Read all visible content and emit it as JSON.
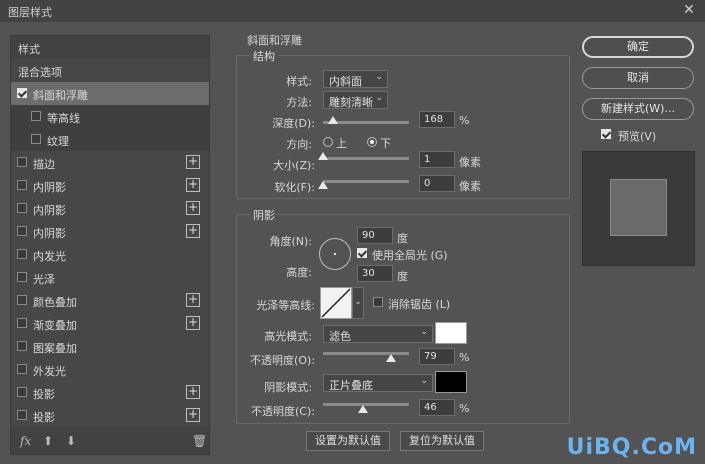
{
  "window": {
    "title": "图层样式",
    "close_glyph": "✕"
  },
  "left_panel": {
    "styles_header": "样式",
    "blend_options": "混合选项",
    "items": [
      {
        "label": "斜面和浮雕",
        "checked": true,
        "selected": true,
        "has_plus": false
      },
      {
        "label": "等高线",
        "checked": false,
        "sub": true,
        "has_plus": false
      },
      {
        "label": "纹理",
        "checked": false,
        "sub": true,
        "has_plus": false
      },
      {
        "label": "描边",
        "checked": false,
        "has_plus": true
      },
      {
        "label": "内阴影",
        "checked": false,
        "has_plus": true
      },
      {
        "label": "内阴影",
        "checked": false,
        "has_plus": true
      },
      {
        "label": "内阴影",
        "checked": false,
        "has_plus": true
      },
      {
        "label": "内发光",
        "checked": false,
        "has_plus": false
      },
      {
        "label": "光泽",
        "checked": false,
        "has_plus": false
      },
      {
        "label": "颜色叠加",
        "checked": false,
        "has_plus": true
      },
      {
        "label": "渐变叠加",
        "checked": false,
        "has_plus": true
      },
      {
        "label": "图案叠加",
        "checked": false,
        "has_plus": false
      },
      {
        "label": "外发光",
        "checked": false,
        "has_plus": false
      },
      {
        "label": "投影",
        "checked": false,
        "has_plus": true
      },
      {
        "label": "投影",
        "checked": false,
        "has_plus": true
      }
    ],
    "plus_glyph": "+",
    "toolbar": {
      "fx": "fx",
      "up": "⬆",
      "down": "⬇",
      "trash": "🗑"
    }
  },
  "bevel": {
    "section_title": "斜面和浮雕",
    "structure": {
      "legend": "结构",
      "style_label": "样式:",
      "style_value": "内斜面",
      "method_label": "方法:",
      "method_value": "雕刻清晰",
      "depth_label": "深度(D):",
      "depth_value": "168",
      "depth_unit": "%",
      "depth_level": 0.12,
      "direction_label": "方向:",
      "dir_up": "上",
      "dir_down": "下",
      "direction_selected": "下",
      "size_label": "大小(Z):",
      "size_value": "1",
      "size_unit": "像素",
      "size_level": 0.0,
      "soften_label": "软化(F):",
      "soften_value": "0",
      "soften_unit": "像素",
      "soften_level": 0.0
    },
    "shading": {
      "legend": "阴影",
      "angle_label": "角度(N):",
      "angle_value": "90",
      "angle_unit": "度",
      "global_light_label": "使用全局光 (G)",
      "global_light_checked": true,
      "altitude_label": "高度:",
      "altitude_value": "30",
      "altitude_unit": "度",
      "gloss_contour_label": "光泽等高线:",
      "anti_alias_label": "消除锯齿 (L)",
      "anti_alias_checked": false,
      "highlight_mode_label": "高光模式:",
      "highlight_mode_value": "滤色",
      "highlight_color": "#ffffff",
      "highlight_opacity_label": "不透明度(O):",
      "highlight_opacity_value": "79",
      "highlight_opacity_unit": "%",
      "highlight_opacity_level": 0.79,
      "shadow_mode_label": "阴影模式:",
      "shadow_mode_value": "正片叠底",
      "shadow_color": "#000000",
      "shadow_opacity_label": "不透明度(C):",
      "shadow_opacity_value": "46",
      "shadow_opacity_unit": "%",
      "shadow_opacity_level": 0.46
    },
    "set_default": "设置为默认值",
    "reset_default": "复位为默认值"
  },
  "right_panel": {
    "ok": "确定",
    "cancel": "取消",
    "new_style": "新建样式(W)...",
    "preview_label": "预览(V)",
    "preview_checked": true
  },
  "watermark": "UiBQ.CoM"
}
